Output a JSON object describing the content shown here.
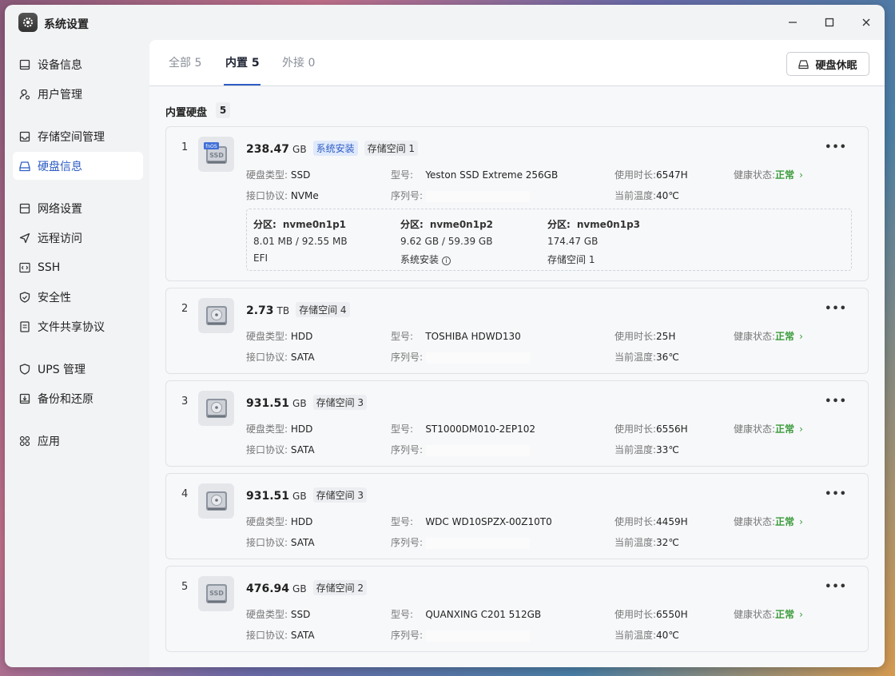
{
  "app": {
    "title": "系统设置"
  },
  "sidebar": {
    "items": [
      {
        "label": "设备信息"
      },
      {
        "label": "用户管理"
      },
      {
        "label": "存储空间管理"
      },
      {
        "label": "硬盘信息"
      },
      {
        "label": "网络设置"
      },
      {
        "label": "远程访问"
      },
      {
        "label": "SSH"
      },
      {
        "label": "安全性"
      },
      {
        "label": "文件共享协议"
      },
      {
        "label": "UPS 管理"
      },
      {
        "label": "备份和还原"
      },
      {
        "label": "应用"
      }
    ],
    "active_index": 3
  },
  "tabs": [
    {
      "label": "全部 5"
    },
    {
      "label": "内置 5"
    },
    {
      "label": "外接 0"
    }
  ],
  "toolbar": {
    "sleep_label": "硬盘休眠"
  },
  "section": {
    "title": "内置硬盘",
    "count": "5"
  },
  "labels": {
    "type": "硬盘类型:",
    "interface": "接口协议:",
    "model": "型号:",
    "serial": "序列号:",
    "hours": "使用时长:",
    "temp": "当前温度:",
    "health": "健康状态:",
    "partition": "分区:"
  },
  "disks": [
    {
      "index": "1",
      "capacity": "238.47",
      "unit": "GB",
      "os_badge": "fnOS",
      "media_text": "SSD",
      "badges": [
        "系统安装",
        "存储空间 1"
      ],
      "type": "SSD",
      "interface": "NVMe",
      "model": "Yeston SSD Extreme 256GB",
      "serial": "",
      "hours": "6547H",
      "temp": "40℃",
      "health": "正常",
      "partitions": [
        {
          "name": "nvme0n1p1",
          "size": "8.01 MB / 92.55 MB",
          "usage": "EFI"
        },
        {
          "name": "nvme0n1p2",
          "size": "9.62 GB / 59.39 GB",
          "usage": "系统安装"
        },
        {
          "name": "nvme0n1p3",
          "size": "174.47 GB",
          "usage": "存储空间 1"
        }
      ]
    },
    {
      "index": "2",
      "capacity": "2.73",
      "unit": "TB",
      "badges": [
        "存储空间 4"
      ],
      "type": "HDD",
      "interface": "SATA",
      "model": "TOSHIBA HDWD130",
      "serial": "",
      "hours": "25H",
      "temp": "36℃",
      "health": "正常"
    },
    {
      "index": "3",
      "capacity": "931.51",
      "unit": "GB",
      "badges": [
        "存储空间 3"
      ],
      "type": "HDD",
      "interface": "SATA",
      "model": "ST1000DM010-2EP102",
      "serial": "",
      "hours": "6556H",
      "temp": "33℃",
      "health": "正常"
    },
    {
      "index": "4",
      "capacity": "931.51",
      "unit": "GB",
      "badges": [
        "存储空间 3"
      ],
      "type": "HDD",
      "interface": "SATA",
      "model": "WDC WD10SPZX-00Z10T0",
      "serial": "",
      "hours": "4459H",
      "temp": "32℃",
      "health": "正常"
    },
    {
      "index": "5",
      "capacity": "476.94",
      "unit": "GB",
      "media_text": "SSD",
      "badges": [
        "存储空间 2"
      ],
      "type": "SSD",
      "interface": "SATA",
      "model": "QUANXING C201 512GB",
      "serial": "",
      "hours": "6550H",
      "temp": "40℃",
      "health": "正常"
    }
  ],
  "colors": {
    "accent": "#2f5ec4",
    "health": "#3a9b3a"
  }
}
